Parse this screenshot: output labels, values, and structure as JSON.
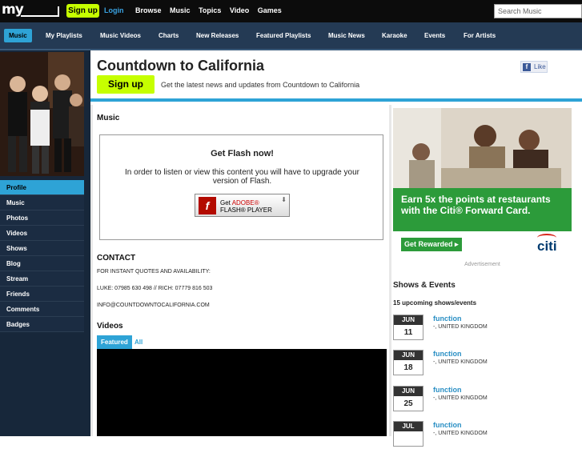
{
  "topbar": {
    "logo": "my",
    "signup": "Sign up",
    "login": "Login",
    "nav": [
      "Browse",
      "Music",
      "Topics",
      "Video",
      "Games"
    ],
    "search_placeholder": "Search Music"
  },
  "subnav": [
    "Music",
    "My Playlists",
    "Music Videos",
    "Charts",
    "New Releases",
    "Featured Playlists",
    "Music News",
    "Karaoke",
    "Events",
    "For Artists"
  ],
  "sidebar": {
    "items": [
      "Profile",
      "Music",
      "Photos",
      "Videos",
      "Shows",
      "Blog",
      "Stream",
      "Friends",
      "Comments",
      "Badges"
    ]
  },
  "header": {
    "title": "Countdown to California",
    "signup": "Sign up",
    "tagline": "Get the latest news and updates from Countdown to California",
    "like": "Like"
  },
  "music": {
    "section_title": "Music",
    "flash_title": "Get Flash now!",
    "flash_text": "In order to listen or view this content you will have to upgrade your version of Flash.",
    "flash_button_line1_a": "Get ",
    "flash_button_line1_b": "ADOBE®",
    "flash_button_line2": "FLASH® PLAYER"
  },
  "contact": {
    "title": "CONTACT",
    "lines": [
      "FOR INSTANT QUOTES AND AVAILABILITY:",
      "LUKE: 07985 630 498 // RICH: 07779 816 503",
      "INFO@COUNTDOWNTOCALIFORNIA.COM"
    ]
  },
  "videos": {
    "title": "Videos",
    "tabs": [
      "Featured",
      "All"
    ]
  },
  "ad": {
    "headline": "Earn 5x the points at restaurants with the Citi® Forward Card.",
    "button": "Get Rewarded ▸",
    "brand": "citi",
    "label": "Advertisement"
  },
  "events": {
    "title": "Shows & Events",
    "count": "15 upcoming shows/events",
    "items": [
      {
        "month": "JUN",
        "day": "11",
        "name": "function",
        "location": "-, UNITED KINGDOM"
      },
      {
        "month": "JUN",
        "day": "18",
        "name": "function",
        "location": "-, UNITED KINGDOM"
      },
      {
        "month": "JUN",
        "day": "25",
        "name": "function",
        "location": "-, UNITED KINGDOM"
      },
      {
        "month": "JUL",
        "day": "",
        "name": "function",
        "location": "-, UNITED KINGDOM"
      }
    ]
  }
}
